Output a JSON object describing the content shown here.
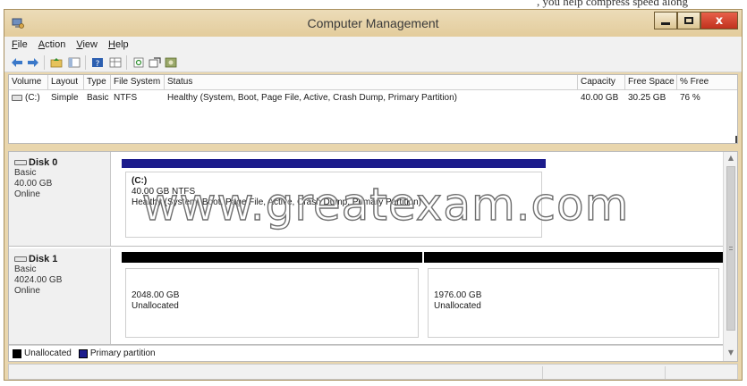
{
  "cropped_caption": ", you help compress speed along",
  "window": {
    "title": "Computer Management",
    "controls": {
      "minimize_icon": "minimize-icon",
      "maximize_icon": "maximize-icon",
      "close_icon": "close-icon",
      "close_label": "x"
    }
  },
  "menu": {
    "file": {
      "mnemonic": "F",
      "rest": "ile"
    },
    "action": {
      "mnemonic": "A",
      "rest": "ction"
    },
    "view": {
      "mnemonic": "V",
      "rest": "iew"
    },
    "help": {
      "mnemonic": "H",
      "rest": "elp"
    }
  },
  "toolbar": {
    "icons": [
      "back-arrow-icon",
      "forward-arrow-icon",
      "up-folder-icon",
      "show-hide-tree-icon",
      "help-icon",
      "properties-grid-icon",
      "refresh-icon",
      "export-icon",
      "settings-icon"
    ]
  },
  "volume_list": {
    "columns": [
      "Volume",
      "Layout",
      "Type",
      "File System",
      "Status",
      "Capacity",
      "Free Space",
      "% Free"
    ],
    "row": {
      "volume": "(C:)",
      "layout": "Simple",
      "type": "Basic",
      "file_system": "NTFS",
      "status": "Healthy (System, Boot, Page File, Active, Crash Dump, Primary Partition)",
      "capacity": "40.00 GB",
      "free_space": "30.25 GB",
      "percent_free": "76 %"
    }
  },
  "disks": [
    {
      "name": "Disk 0",
      "type": "Basic",
      "size": "40.00 GB",
      "status": "Online",
      "partitions": [
        {
          "name": "(C:)",
          "detail": "40.00 GB NTFS",
          "status": "Healthy (System, Boot, Page File, Active, Crash Dump, Primary Partition)",
          "kind": "primary"
        }
      ]
    },
    {
      "name": "Disk 1",
      "type": "Basic",
      "size": "4024.00 GB",
      "status": "Online",
      "partitions": [
        {
          "size": "2048.00 GB",
          "state": "Unallocated",
          "kind": "unallocated"
        },
        {
          "size": "1976.00 GB",
          "state": "Unallocated",
          "kind": "unallocated"
        }
      ]
    }
  ],
  "legend": [
    {
      "label": "Unallocated",
      "color": "#000000"
    },
    {
      "label": "Primary partition",
      "color": "#1c1c8c"
    }
  ],
  "watermark": "www.greatexam.com",
  "colors": {
    "titlebar": "#e6d1a4",
    "primary_partition": "#1c1c8c",
    "unallocated": "#000000",
    "close_button": "#c9351f"
  }
}
